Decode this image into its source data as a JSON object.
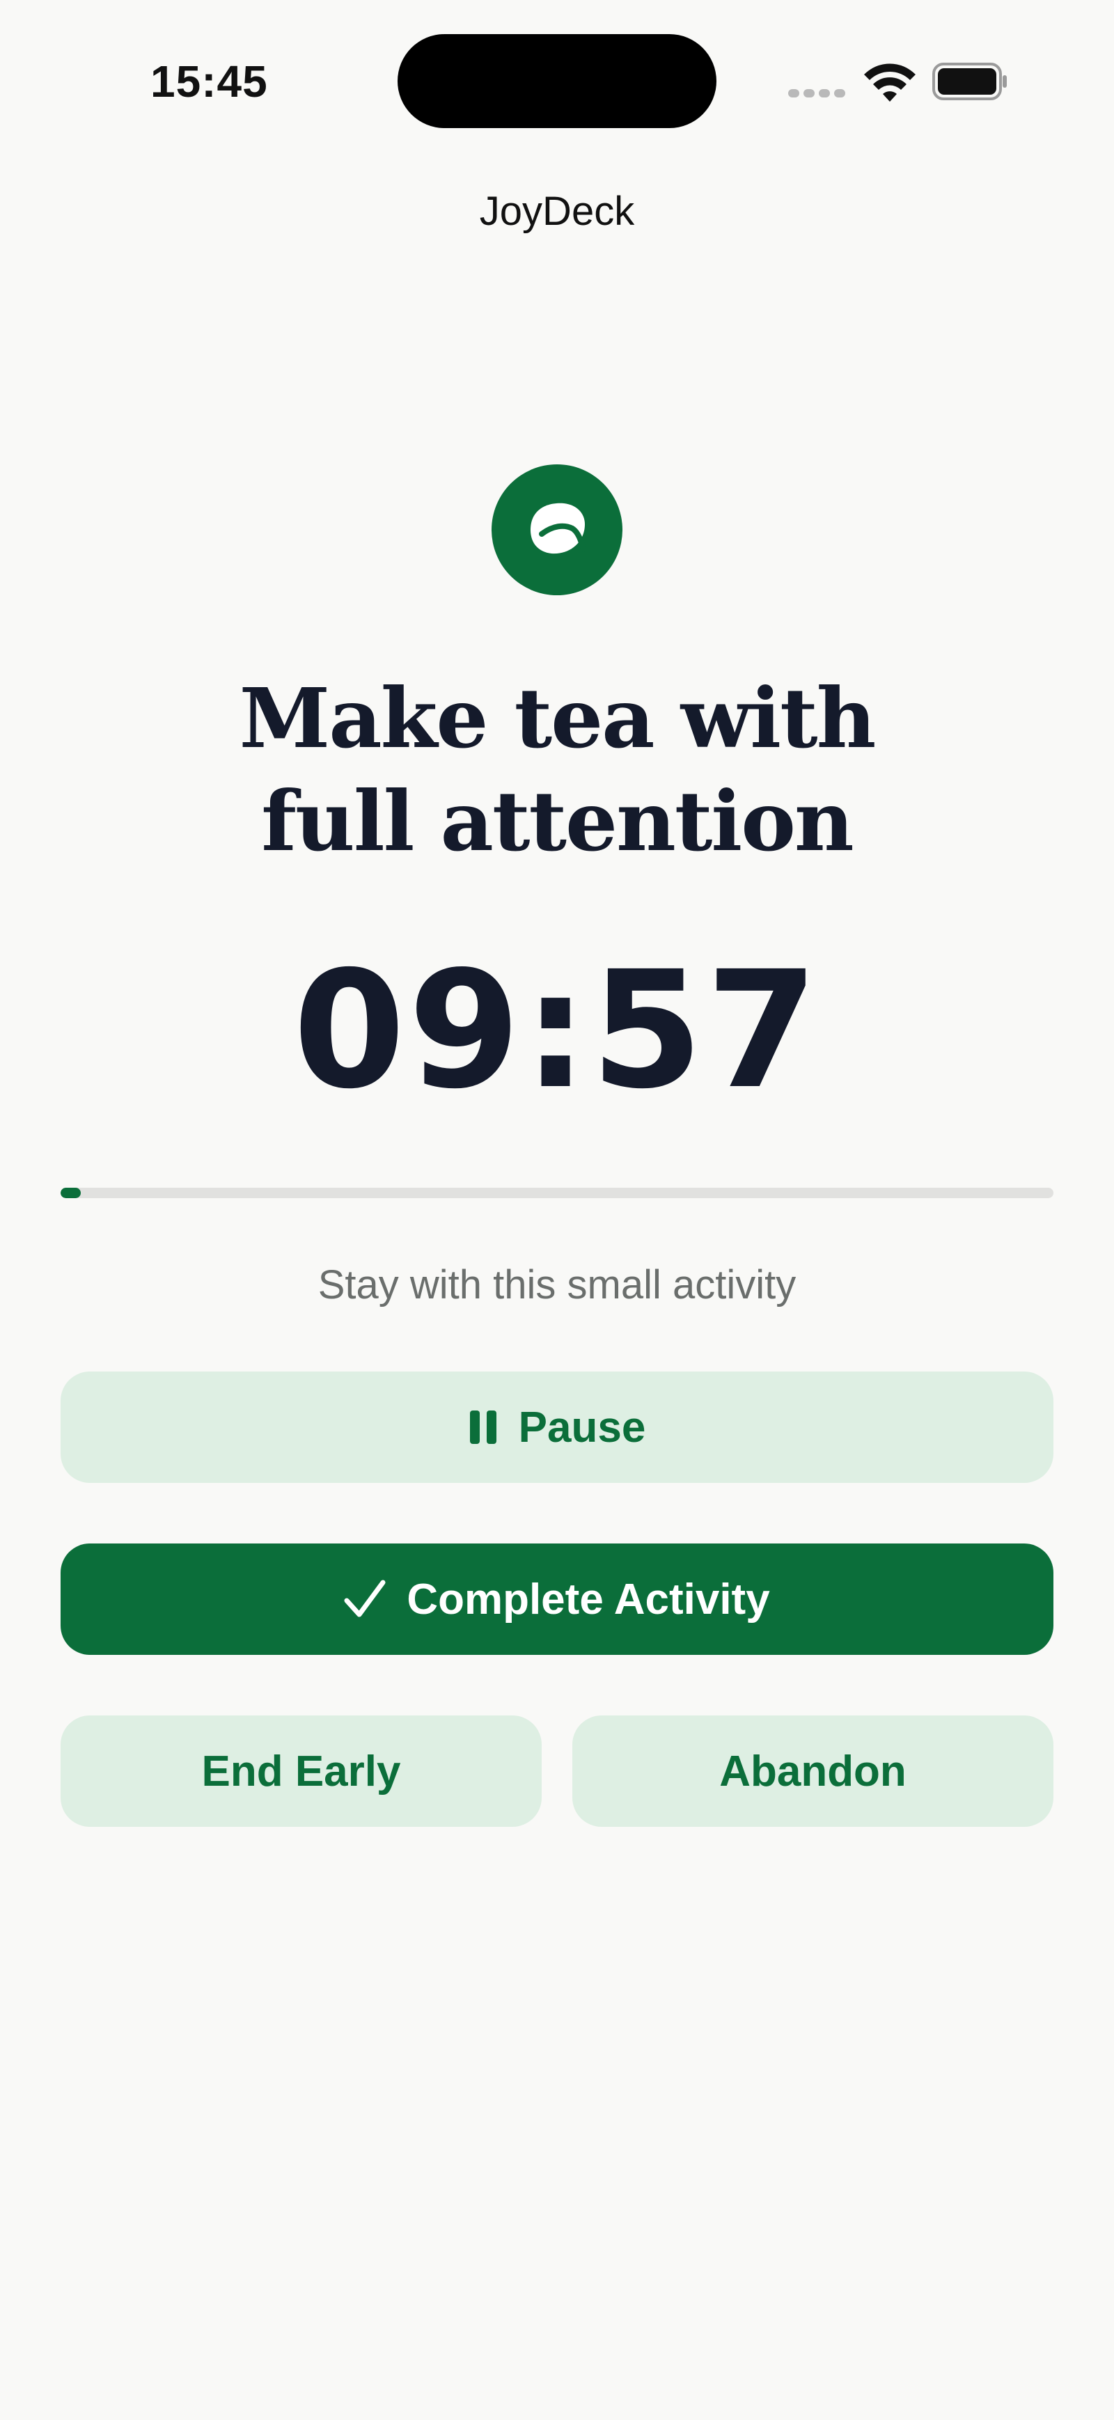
{
  "status_bar": {
    "time": "15:45"
  },
  "app": {
    "title": "JoyDeck"
  },
  "activity": {
    "icon": "leaf-icon",
    "title_line1": "Make tea with",
    "title_line2": "full attention",
    "timer": "09:57",
    "progress_percent": 2,
    "subtitle": "Stay with this small activity"
  },
  "actions": {
    "pause_label": "Pause",
    "pause_icon": "pause-icon",
    "complete_label": "Complete Activity",
    "complete_icon": "checkmark-icon",
    "end_early_label": "End Early",
    "abandon_label": "Abandon"
  },
  "colors": {
    "accent": "#0b6e3a",
    "accent_soft": "#deefe3",
    "background": "#f9f9f7",
    "text_primary": "#141a2b",
    "text_secondary": "#6a6e6c"
  }
}
